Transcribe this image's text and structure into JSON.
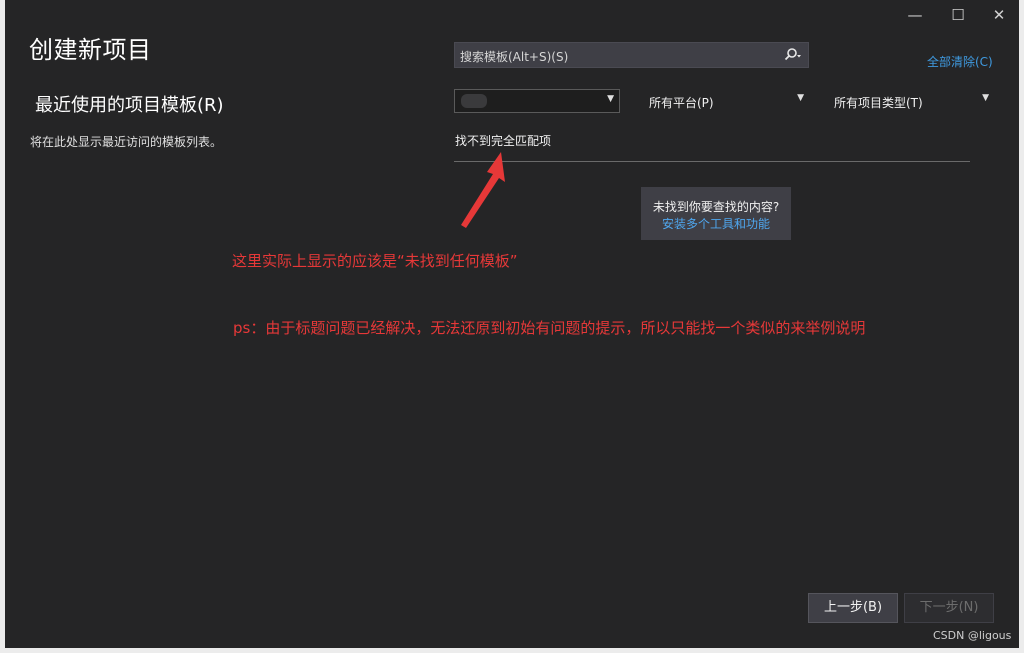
{
  "window": {
    "title": "创建新项目",
    "controls": {
      "minimize": "—",
      "maximize": "☐",
      "close": "✕"
    }
  },
  "recent": {
    "heading": "最近使用的项目模板(R)",
    "description": "将在此处显示最近访问的模板列表。"
  },
  "search": {
    "placeholder": "搜索模板(Alt+S)(S)",
    "icon": "search-icon"
  },
  "clear_all": "全部清除(C)",
  "filters": {
    "language": "",
    "platform": "所有平台(P)",
    "project_type": "所有项目类型(T)"
  },
  "results": {
    "no_match": "找不到完全匹配项"
  },
  "hint": {
    "question": "未找到你要查找的内容?",
    "link": "安装多个工具和功能"
  },
  "annotations": {
    "note1": "这里实际上显示的应该是“未找到任何模板”",
    "note2": "ps：由于标题问题已经解决，无法还原到初始有问题的提示，所以只能找一个类似的来举例说明"
  },
  "footer": {
    "back": "上一步(B)",
    "next": "下一步(N)"
  },
  "watermark": "CSDN @ligous",
  "colors": {
    "background": "#252526",
    "accent_link": "#3f9ae0",
    "annotation_red": "#e63838"
  }
}
